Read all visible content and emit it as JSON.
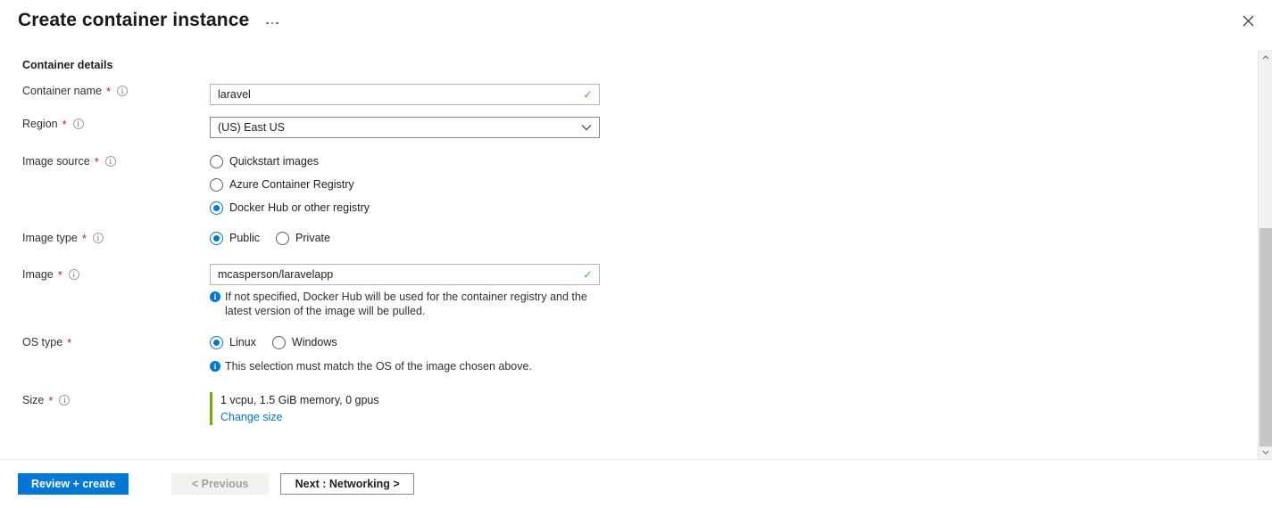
{
  "header": {
    "title": "Create container instance",
    "ellipsis_label": "...",
    "close_label": "✕"
  },
  "section": {
    "title": "Container details"
  },
  "fields": {
    "container_name": {
      "label": "Container name",
      "required": "*",
      "info": "i",
      "value": "laravel",
      "valid_mark": "✓"
    },
    "region": {
      "label": "Region",
      "required": "*",
      "info": "i",
      "value": "(US) East US"
    },
    "image_source": {
      "label": "Image source",
      "required": "*",
      "info": "i",
      "options": [
        {
          "label": "Quickstart images",
          "selected": false
        },
        {
          "label": "Azure Container Registry",
          "selected": false
        },
        {
          "label": "Docker Hub or other registry",
          "selected": true
        }
      ]
    },
    "image_type": {
      "label": "Image type",
      "required": "*",
      "info": "i",
      "options": [
        {
          "label": "Public",
          "selected": true
        },
        {
          "label": "Private",
          "selected": false
        }
      ]
    },
    "image": {
      "label": "Image",
      "required": "*",
      "info": "i",
      "value": "mcasperson/laravelapp",
      "valid_mark": "✓",
      "hint_icon": "i",
      "hint": "If not specified, Docker Hub will be used for the container registry and the latest version of the image will be pulled."
    },
    "os_type": {
      "label": "OS type",
      "required": "*",
      "options": [
        {
          "label": "Linux",
          "selected": true
        },
        {
          "label": "Windows",
          "selected": false
        }
      ],
      "hint_icon": "i",
      "hint": "This selection must match the OS of the image chosen above."
    },
    "size": {
      "label": "Size",
      "required": "*",
      "info": "i",
      "summary": "1 vcpu, 1.5 GiB memory, 0 gpus",
      "change_link": "Change size"
    }
  },
  "footer": {
    "review_create": "Review + create",
    "previous": "< Previous",
    "next": "Next : Networking >"
  },
  "colors": {
    "accent_blue": "#0078d4",
    "valid_green": "#5bb85b",
    "size_bar_green": "#6bb700",
    "required_red": "#a4262c",
    "input_border_purple": "#c9a8cd"
  }
}
